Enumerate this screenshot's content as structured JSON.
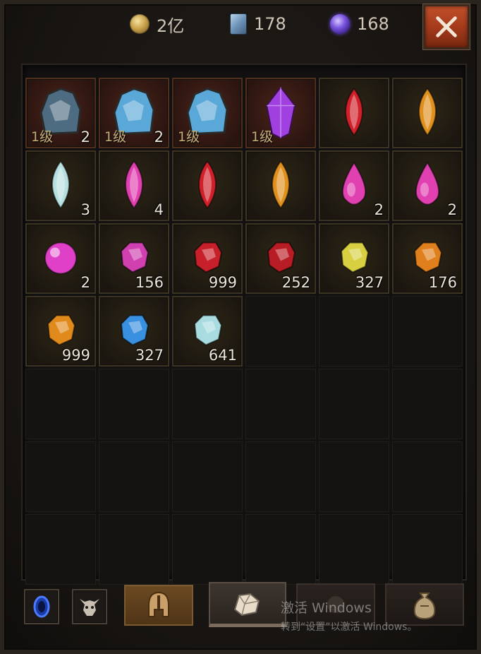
{
  "currencies": [
    {
      "icon": "gold-coin-icon",
      "value": "2亿"
    },
    {
      "icon": "scroll-icon",
      "value": "178"
    },
    {
      "icon": "purple-orb-icon",
      "value": "168"
    }
  ],
  "close_button": {
    "icon": "close-icon"
  },
  "items": [
    {
      "name": "dark-ore-stone",
      "level": "1级",
      "count": "2",
      "color": "#4d6c82"
    },
    {
      "name": "blue-ore-stone",
      "level": "1级",
      "count": "2",
      "color": "#5aa8d8"
    },
    {
      "name": "blue-ore-stone",
      "level": "1级",
      "count": "",
      "color": "#5aa8d8"
    },
    {
      "name": "purple-crystal",
      "level": "1级",
      "count": "",
      "color": "#a040e0"
    },
    {
      "name": "red-marquise-gem",
      "level": "",
      "count": "",
      "color": "#d0202a"
    },
    {
      "name": "amber-marquise-gem",
      "level": "",
      "count": "",
      "color": "#e0901c"
    },
    {
      "name": "white-marquise-gem",
      "level": "",
      "count": "3",
      "color": "#b8e0e0"
    },
    {
      "name": "pink-marquise-gem",
      "level": "",
      "count": "4",
      "color": "#e040b0"
    },
    {
      "name": "red-marquise-gem",
      "level": "",
      "count": "",
      "color": "#d0202a"
    },
    {
      "name": "amber-marquise-gem",
      "level": "",
      "count": "",
      "color": "#e0901c"
    },
    {
      "name": "pink-teardrop-gem",
      "level": "",
      "count": "2",
      "color": "#e040b0"
    },
    {
      "name": "pink-teardrop-gem",
      "level": "",
      "count": "2",
      "color": "#e040b0"
    },
    {
      "name": "pink-orb",
      "level": "",
      "count": "2",
      "color": "#e040c8"
    },
    {
      "name": "pink-rough-gem",
      "level": "",
      "count": "156",
      "color": "#d040b0"
    },
    {
      "name": "red-rough-gem",
      "level": "",
      "count": "999",
      "color": "#c8202a"
    },
    {
      "name": "red-rough-gem",
      "level": "",
      "count": "252",
      "color": "#b81c24"
    },
    {
      "name": "yellow-rough-gem",
      "level": "",
      "count": "327",
      "color": "#d8d040"
    },
    {
      "name": "orange-rough-gem",
      "level": "",
      "count": "176",
      "color": "#e0801c"
    },
    {
      "name": "orange-rough-gem",
      "level": "",
      "count": "999",
      "color": "#e08a1c"
    },
    {
      "name": "blue-rough-gem",
      "level": "",
      "count": "327",
      "color": "#3a90e0"
    },
    {
      "name": "white-rough-gem",
      "level": "",
      "count": "641",
      "color": "#a8dce0"
    }
  ],
  "tabs": [
    {
      "icon": "blue-portal-icon"
    },
    {
      "icon": "demon-skull-icon"
    },
    {
      "icon": "helmet-icon"
    },
    {
      "icon": "gem-bag-icon"
    },
    {
      "icon": "empty-tab-icon"
    },
    {
      "icon": "money-bag-icon"
    }
  ],
  "watermark": {
    "line1": "激活 Windows",
    "line2": "转到“设置”以激活 Windows。"
  }
}
